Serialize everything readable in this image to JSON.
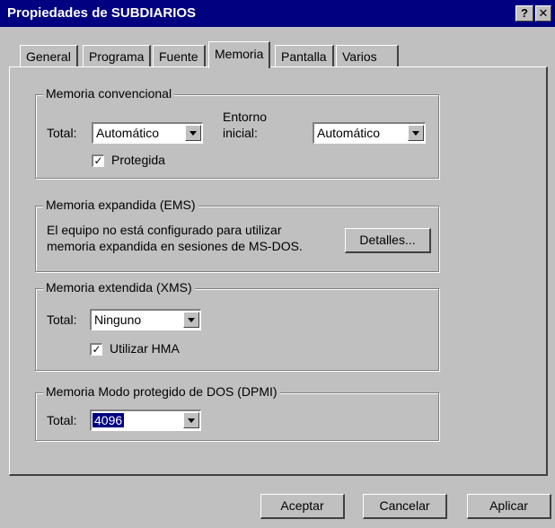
{
  "window": {
    "title": "Propiedades de SUBDIARIOS",
    "help_btn": "?",
    "close_btn": "✕"
  },
  "tabs": [
    {
      "label": "General"
    },
    {
      "label": "Programa"
    },
    {
      "label": "Fuente"
    },
    {
      "label": "Memoria"
    },
    {
      "label": "Pantalla"
    },
    {
      "label": "Varios"
    }
  ],
  "conv": {
    "legend": "Memoria convencional",
    "total_label": "Total:",
    "total_value": "Automático",
    "entorno_label_1": "Entorno",
    "entorno_label_2": "inicial:",
    "entorno_value": "Automático",
    "protegida_label": "Protegida",
    "protegida_checked": "✓"
  },
  "ems": {
    "legend": "Memoria expandida (EMS)",
    "text_1": "El equipo no está configurado para utilizar",
    "text_2": "memoria expandida en sesiones de MS-DOS.",
    "details_button": "Detalles..."
  },
  "xms": {
    "legend": "Memoria extendida (XMS)",
    "total_label": "Total:",
    "total_value": "Ninguno",
    "hma_label": "Utilizar HMA",
    "hma_checked": "✓"
  },
  "dpmi": {
    "legend": "Memoria Modo protegido de DOS (DPMI)",
    "total_label": "Total:",
    "total_value": "4096"
  },
  "footer": {
    "accept": "Aceptar",
    "cancel": "Cancelar",
    "apply": "Aplicar"
  }
}
